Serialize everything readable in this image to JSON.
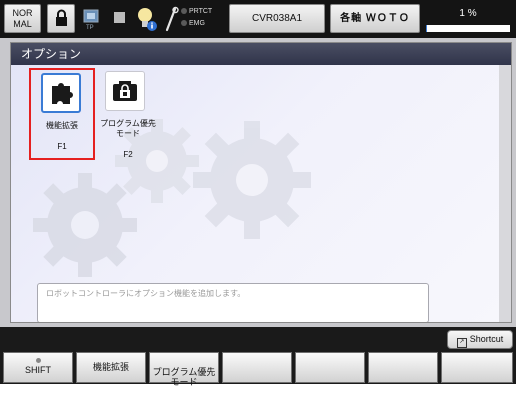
{
  "topbar": {
    "mode": "NOR\nMAL",
    "tp_label": "TP",
    "status_prtct": "PRTCT",
    "status_emg": "EMG",
    "program": "CVR038A1",
    "axis": "各軸 ＷＯＴＯ",
    "speed": "1 %",
    "speed_value": 1
  },
  "dialog": {
    "title": "オプション",
    "options": [
      {
        "label": "機能拡張",
        "key": "F1",
        "selected": true,
        "icon": "puzzle-icon"
      },
      {
        "label": "プログラム優先\nモード",
        "key": "F2",
        "selected": false,
        "icon": "lock-program-icon"
      }
    ],
    "description": "ロボットコントローラにオプション機能を追加します。"
  },
  "bottom": {
    "shortcut": "Shortcut",
    "fkeys": [
      "SHIFT",
      "機能拡張",
      "プログラム優先\nモード",
      "",
      "",
      "",
      ""
    ]
  },
  "colors": {
    "accent_blue": "#3a7bd5",
    "selection_red": "#e52020",
    "title_bar": "#3b3f55"
  }
}
